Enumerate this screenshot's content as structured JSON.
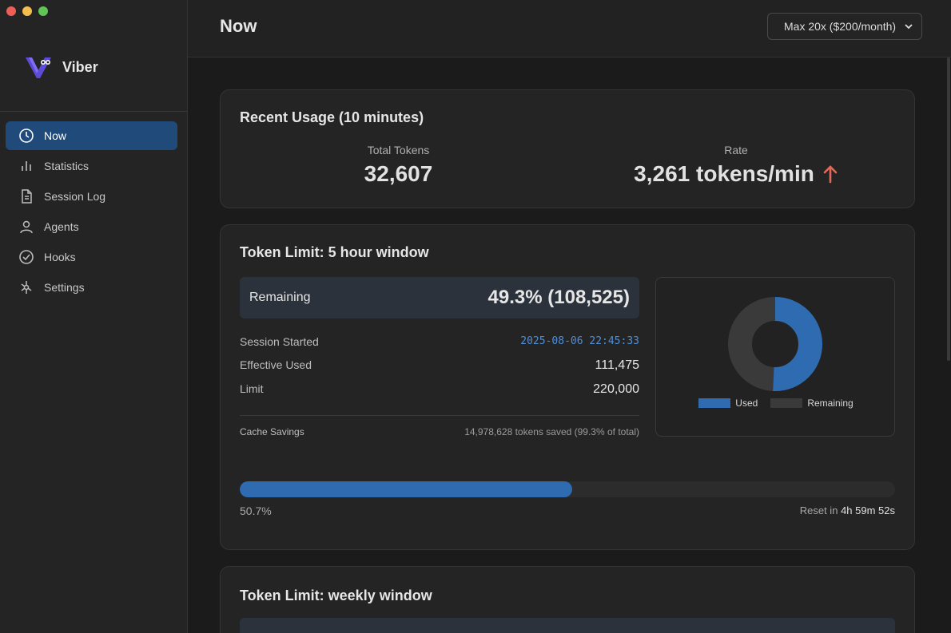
{
  "app": {
    "name": "Viber"
  },
  "sidebar": {
    "items": [
      {
        "label": "Now",
        "icon": "clock-icon",
        "active": true
      },
      {
        "label": "Statistics",
        "icon": "bar-chart-icon"
      },
      {
        "label": "Session Log",
        "icon": "document-icon"
      },
      {
        "label": "Agents",
        "icon": "person-icon"
      },
      {
        "label": "Hooks",
        "icon": "check-circle-icon"
      },
      {
        "label": "Settings",
        "icon": "settings-icon"
      }
    ]
  },
  "header": {
    "title": "Now",
    "plan": "Max 20x ($200/month)"
  },
  "recent": {
    "title": "Recent Usage (10 minutes)",
    "total_label": "Total Tokens",
    "total_value": "32,607",
    "rate_label": "Rate",
    "rate_value": "3,261 tokens/min"
  },
  "five_hour": {
    "title": "Token Limit: 5 hour window",
    "remaining_label": "Remaining",
    "remaining_value": "49.3% (108,525)",
    "session_started_label": "Session Started",
    "session_started_value": "2025-08-06 22:45:33",
    "effective_used_label": "Effective Used",
    "effective_used_value": "111,475",
    "limit_label": "Limit",
    "limit_value": "220,000",
    "cache_label": "Cache Savings",
    "cache_value": "14,978,628 tokens saved (99.3% of total)",
    "progress_label": "50.7%",
    "progress_fraction": 0.507,
    "reset_prefix": "Reset in",
    "reset_value": "4h 59m 52s"
  },
  "donut": {
    "used_label": "Used",
    "remaining_label": "Remaining",
    "used_fraction": 0.507,
    "used_color": "#2f6bb0",
    "remaining_color": "#3a3a3a"
  },
  "weekly": {
    "title": "Token Limit: weekly window"
  },
  "colors": {
    "accent": "#1f4a7a",
    "rate_up": "#e4685a"
  }
}
